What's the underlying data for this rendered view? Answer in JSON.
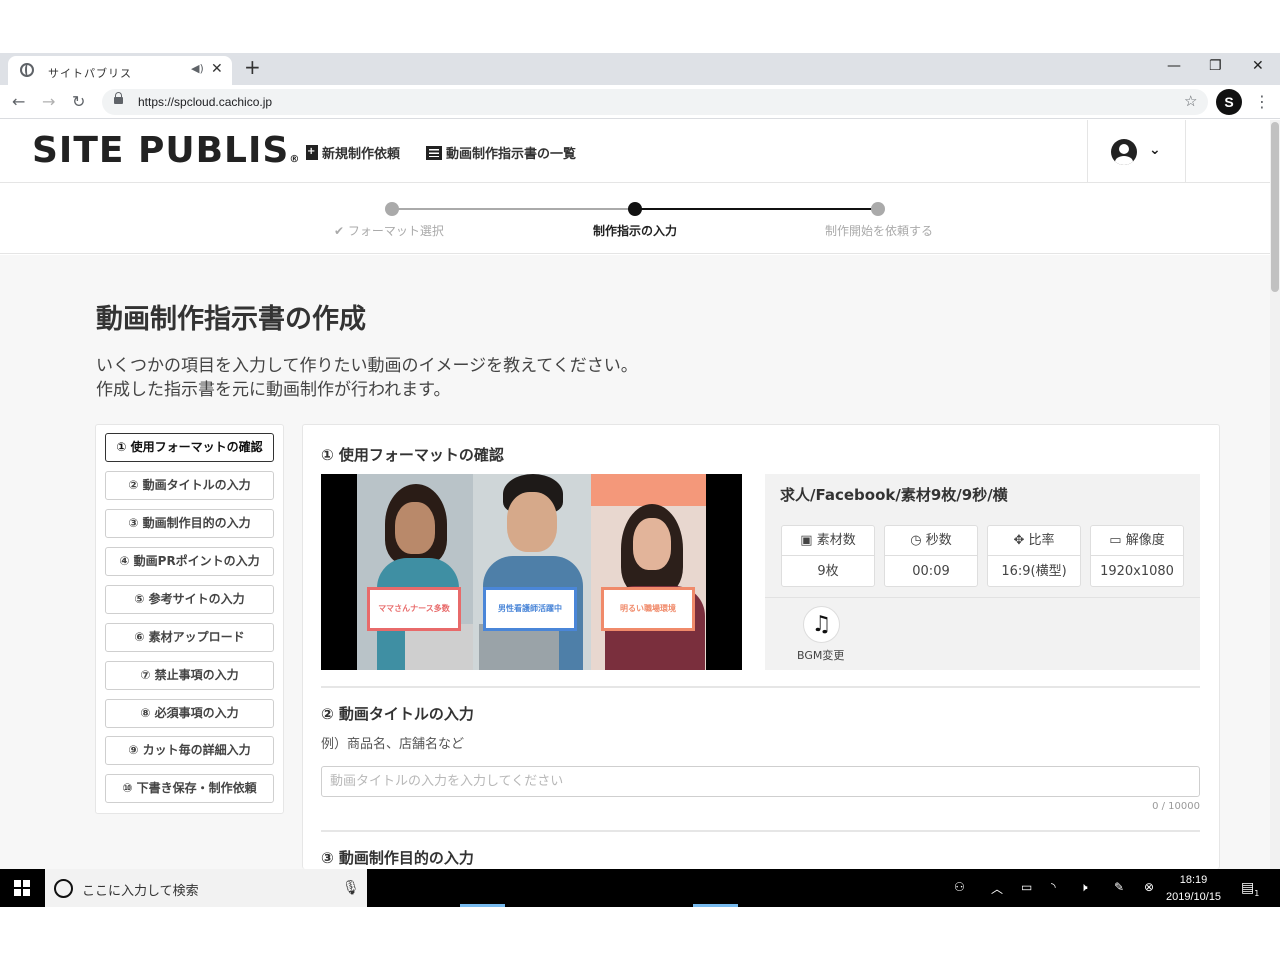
{
  "browser": {
    "tab_title": "サイトパブリス",
    "url": "https://spcloud.cachico.jp",
    "profile_initial": "S"
  },
  "header": {
    "logo": "SITE PUBLIS",
    "logo_mark": "®",
    "nav": [
      "新規制作依頼",
      "動画制作指示書の一覧"
    ]
  },
  "stepper": {
    "steps": [
      {
        "label": "フォーマット選択",
        "state": "done",
        "check": "✔"
      },
      {
        "label": "制作指示の入力",
        "state": "current"
      },
      {
        "label": "制作開始を依頼する",
        "state": "upcoming"
      }
    ]
  },
  "page": {
    "title": "動画制作指示書の作成",
    "desc_line1": "いくつかの項目を入力して作りたい動画のイメージを教えてください。",
    "desc_line2": "作成した指示書を元に動画制作が行われます。"
  },
  "sidenav": {
    "items": [
      "① 使用フォーマットの確認",
      "② 動画タイトルの入力",
      "③ 動画制作目的の入力",
      "④ 動画PRポイントの入力",
      "⑤ 参考サイトの入力",
      "⑥ 素材アップロード",
      "⑦ 禁止事項の入力",
      "⑧ 必須事項の入力",
      "⑨ カット毎の詳細入力",
      "⑩ 下書き保存・制作依頼"
    ],
    "active_index": 0
  },
  "section1": {
    "title": "① 使用フォーマットの確認",
    "video_labels": [
      "ママさんナース多数",
      "男性看護師活躍中",
      "明るい職場環境"
    ],
    "video_label_colors": [
      "#e86a6a",
      "#4a86d8",
      "#f08a6a"
    ],
    "format_name": "求人/Facebook/素材9枚/9秒/横",
    "stats": [
      {
        "icon": "image-icon",
        "glyph": "▣",
        "label": "素材数",
        "value": "9枚"
      },
      {
        "icon": "clock-icon",
        "glyph": "◷",
        "label": "秒数",
        "value": "00:09"
      },
      {
        "icon": "expand-icon",
        "glyph": "✥",
        "label": "比率",
        "value": "16:9(横型)"
      },
      {
        "icon": "monitor-icon",
        "glyph": "▭",
        "label": "解像度",
        "value": "1920x1080"
      }
    ],
    "bgm_glyph": "♫",
    "bgm_label": "BGM変更"
  },
  "section2": {
    "title": "② 動画タイトルの入力",
    "example": "例）商品名、店舗名など",
    "placeholder": "動画タイトルの入力を入力してください",
    "value": "",
    "counter": "0 / 10000"
  },
  "section3": {
    "title": "③ 動画制作目的の入力"
  },
  "taskbar": {
    "search_placeholder": "ここに入力して検索",
    "time": "18:19",
    "date": "2019/10/15",
    "notification_count": "1"
  },
  "colors": {
    "accent_dark": "#111111",
    "stepper_inactive": "#aaaaaa",
    "page_bg": "#f7f7f7"
  }
}
